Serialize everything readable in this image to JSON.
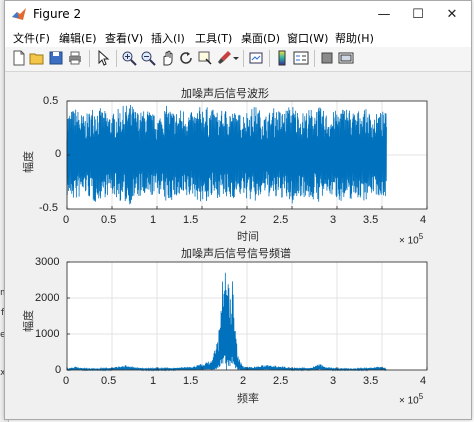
{
  "window": {
    "title": "Figure 2"
  },
  "window_controls": {
    "minimize": "—",
    "maximize": "☐",
    "close": "✕"
  },
  "menu": [
    {
      "label": "文件(F)"
    },
    {
      "label": "编辑(E)"
    },
    {
      "label": "查看(V)"
    },
    {
      "label": "插入(I)"
    },
    {
      "label": "工具(T)"
    },
    {
      "label": "桌面(D)"
    },
    {
      "label": "窗口(W)"
    },
    {
      "label": "帮助(H)"
    }
  ],
  "toolbar_icons": [
    "new-figure-icon",
    "open-file-icon",
    "save-icon",
    "print-icon",
    "pointer-icon",
    "zoom-in-icon",
    "zoom-out-icon",
    "pan-icon",
    "rotate-icon",
    "data-cursor-icon",
    "brush-icon",
    "link-plot-icon",
    "colorbar-icon",
    "legend-icon",
    "hide-tools-icon",
    "dock-icon"
  ],
  "background_strip": [
    "n",
    "f",
    "e",
    "x"
  ],
  "colors": {
    "series": "#0072bd",
    "axes": "#262626",
    "grid": "#e3e3e3",
    "plot_bg": "#ffffff"
  },
  "chart_data": [
    {
      "type": "line",
      "title": "加噪声后信号波形",
      "xlabel": "时间",
      "ylabel": "幅度",
      "xlim": [
        0,
        400000
      ],
      "ylim": [
        -0.5,
        0.5
      ],
      "x_ticks": [
        "0",
        "0.5",
        "1",
        "1.5",
        "2",
        "2.5",
        "3",
        "3.5",
        "4"
      ],
      "y_ticks": [
        "0.5",
        "0",
        "-0.5"
      ],
      "x_exponent": {
        "base": "× 10",
        "power": "5"
      },
      "grid": true,
      "series": [
        {
          "x_range": [
            0,
            355000
          ],
          "envelope_x": [
            0,
            10000,
            20000,
            30000,
            40000,
            50000,
            60000,
            70000,
            80000,
            90000,
            100000,
            110000,
            120000,
            130000,
            140000,
            150000,
            160000,
            170000,
            180000,
            190000,
            200000,
            210000,
            220000,
            230000,
            240000,
            250000,
            260000,
            270000,
            280000,
            290000,
            300000,
            310000,
            320000,
            330000,
            340000,
            350000,
            355000
          ],
          "envelope_max": [
            0.4,
            0.44,
            0.36,
            0.47,
            0.42,
            0.38,
            0.45,
            0.48,
            0.4,
            0.43,
            0.35,
            0.46,
            0.41,
            0.44,
            0.39,
            0.47,
            0.43,
            0.4,
            0.45,
            0.38,
            0.42,
            0.46,
            0.37,
            0.44,
            0.41,
            0.48,
            0.39,
            0.43,
            0.45,
            0.38,
            0.42,
            0.46,
            0.4,
            0.44,
            0.37,
            0.41,
            0.39
          ],
          "envelope_min": [
            -0.39,
            -0.43,
            -0.36,
            -0.45,
            -0.4,
            -0.37,
            -0.44,
            -0.46,
            -0.4,
            -0.42,
            -0.34,
            -0.45,
            -0.41,
            -0.43,
            -0.38,
            -0.46,
            -0.42,
            -0.39,
            -0.44,
            -0.37,
            -0.41,
            -0.45,
            -0.36,
            -0.43,
            -0.4,
            -0.47,
            -0.38,
            -0.42,
            -0.44,
            -0.37,
            -0.41,
            -0.45,
            -0.39,
            -0.43,
            -0.36,
            -0.4,
            -0.38
          ]
        }
      ]
    },
    {
      "type": "line",
      "title": "加噪声后信号信号频谱",
      "xlabel": "频率",
      "ylabel": "幅度",
      "xlim": [
        0,
        400000
      ],
      "ylim": [
        0,
        3000
      ],
      "x_ticks": [
        "0",
        "0.5",
        "1",
        "1.5",
        "2",
        "2.5",
        "3",
        "3.5",
        "4"
      ],
      "y_ticks": [
        "3000",
        "2000",
        "1000",
        "0"
      ],
      "x_exponent": {
        "base": "× 10",
        "power": "5"
      },
      "grid": true,
      "series": [
        {
          "x": [
            0,
            10000,
            15000,
            20000,
            30000,
            50000,
            65000,
            75000,
            85000,
            100000,
            120000,
            140000,
            160000,
            168000,
            172000,
            176000,
            178000,
            180000,
            182000,
            184000,
            186000,
            188000,
            190000,
            195000,
            205000,
            225000,
            240000,
            250000,
            270000,
            280000,
            285000,
            300000,
            320000,
            350000,
            355000
          ],
          "y": [
            20,
            110,
            60,
            40,
            30,
            60,
            140,
            80,
            50,
            40,
            60,
            100,
            260,
            900,
            2500,
            2850,
            2400,
            2800,
            2100,
            2600,
            1500,
            900,
            400,
            120,
            80,
            160,
            100,
            60,
            50,
            180,
            110,
            40,
            30,
            100,
            20
          ]
        }
      ]
    }
  ]
}
